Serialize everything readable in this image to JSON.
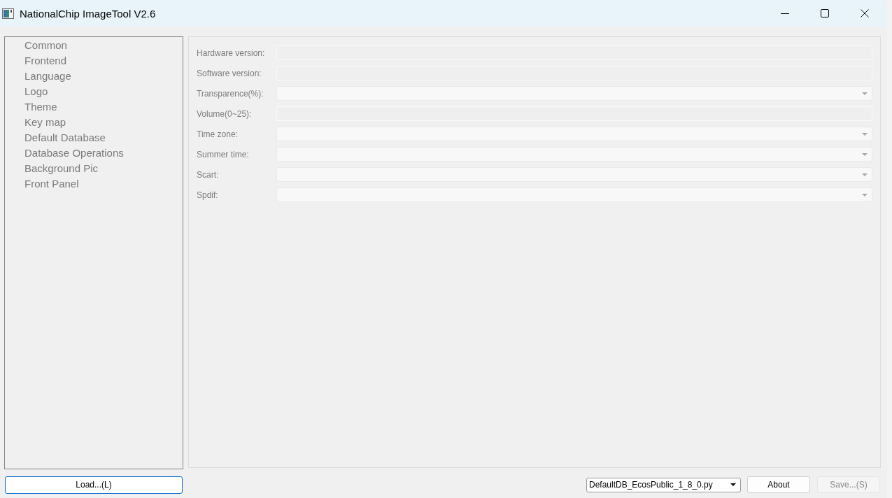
{
  "window": {
    "title": "NationalChip ImageTool V2.6"
  },
  "sidebar": {
    "disabled": true,
    "items": [
      {
        "label": "Common"
      },
      {
        "label": "Frontend"
      },
      {
        "label": "Language"
      },
      {
        "label": "Logo"
      },
      {
        "label": "Theme"
      },
      {
        "label": "Key map"
      },
      {
        "label": "Default Database"
      },
      {
        "label": "Database Operations"
      },
      {
        "label": "Background Pic"
      },
      {
        "label": "Front Panel"
      }
    ]
  },
  "form": {
    "fields": [
      {
        "label": "Hardware version:",
        "kind": "text",
        "disabled": true
      },
      {
        "label": "Software version:",
        "kind": "text",
        "disabled": true
      },
      {
        "label": "Transparence(%):",
        "kind": "combo",
        "disabled": true
      },
      {
        "label": "Volume(0~25):",
        "kind": "text",
        "disabled": true
      },
      {
        "label": "Time zone:",
        "kind": "combo",
        "disabled": true
      },
      {
        "label": "Summer time:",
        "kind": "combo",
        "disabled": true
      },
      {
        "label": "Scart:",
        "kind": "combo",
        "disabled": true
      },
      {
        "label": "Spdif:",
        "kind": "combo",
        "disabled": true
      }
    ]
  },
  "footer": {
    "load_button": {
      "label": "Load...(L)",
      "focused": true
    },
    "database_select": {
      "value": "DefaultDB_EcosPublic_1_8_0.py"
    },
    "buttons": [
      {
        "label": "About",
        "disabled": false
      },
      {
        "label": "Save...(S)",
        "disabled": true
      }
    ]
  }
}
